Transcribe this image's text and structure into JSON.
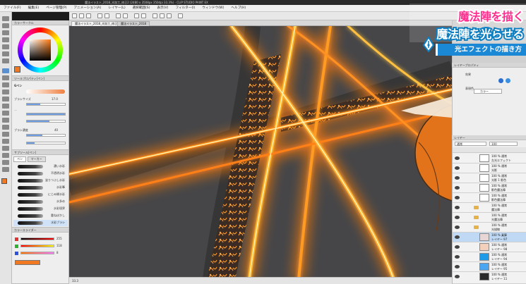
{
  "window": {
    "title": "魔法イラスト_2018_光加工_修正2 (2480 x 3508px 350dpi 33.3%) - CLIP STUDIO PAINT EX"
  },
  "menu": [
    "ファイル(F)",
    "編集(E)",
    "ページ管理(P)",
    "アニメーション(A)",
    "レイヤー(L)",
    "選択範囲(S)",
    "表示(V)",
    "フィルター(I)",
    "ウィンドウ(W)",
    "ヘルプ(H)"
  ],
  "tabs": {
    "canvas_tab": "魔法イラスト_2018_光加工_修正2",
    "canvas_tab2": "魔法イラスト_2018"
  },
  "panels": {
    "color_wheel": {
      "title": "カラーサークル",
      "main_color": "#f07820"
    },
    "tool_property": {
      "title": "ツールプロパティ[ペン]",
      "tool_name": "Gペン",
      "brush_size_label": "ブラシサイズ",
      "brush_size_value": "17.0",
      "brush_density_label": "ブラシ濃度",
      "brush_density_value": "40"
    },
    "sub_tool": {
      "title": "サブツール[ペン]",
      "tabs": [
        "ペン",
        "マーカー"
      ],
      "brushes": [
        "濃い水彩",
        "不透明水彩",
        "塗りつぶし水彩",
        "水彩筆",
        "にじみ縁水彩",
        "水多め",
        "水彩境界",
        "重ねぼかし",
        "水彩ブラシ"
      ],
      "selected_brush_index": 8
    },
    "color_slider": {
      "title": "カラースライダー",
      "values": [
        "255",
        "118",
        "8"
      ]
    }
  },
  "status": {
    "zoom": "33.3"
  },
  "right_panel": {
    "property_title": "レイヤープロパティ",
    "effect_label": "効果",
    "expression_label": "表現色",
    "expression_value": "カラー",
    "layer_title": "レイヤー",
    "blend_mode": "通常",
    "opacity": "100",
    "layers": [
      {
        "mode": "100 % 通常",
        "name": "左光エフェクト",
        "folder": false,
        "thumb": "#ffffff"
      },
      {
        "mode": "100 % 通常",
        "name": "光影",
        "folder": false,
        "thumb": "#ffffff"
      },
      {
        "mode": "100 % 通常",
        "name": "光影 1 影色",
        "folder": false,
        "thumb": "#ffffff"
      },
      {
        "mode": "100 % 通常",
        "name": "影色魔法陣",
        "folder": false,
        "thumb": "#ffffff"
      },
      {
        "mode": "100 % 通常",
        "name": "影色魔法陣",
        "folder": false,
        "thumb": "#ffffff"
      },
      {
        "mode": "100 % 通常",
        "name": "魔法陣",
        "folder": true,
        "thumb": "#ffffff"
      },
      {
        "mode": "100 % 通常",
        "name": "光魔法陣",
        "folder": true,
        "thumb": "#ffffff"
      },
      {
        "mode": "100 % 通常",
        "name": "光描線",
        "folder": true,
        "thumb": "#ffffff"
      },
      {
        "mode": "100 % 乗算",
        "name": "レイヤー 97",
        "folder": false,
        "thumb": "#e8d6d6"
      },
      {
        "mode": "100 % 通常",
        "name": "レイヤー 98",
        "folder": false,
        "thumb": "#f2d0bb"
      },
      {
        "mode": "100 % 通常",
        "name": "レイヤー 94",
        "folder": false,
        "thumb": "#1e9be8"
      },
      {
        "mode": "100 % 通常",
        "name": "レイヤー 95",
        "folder": false,
        "thumb": "#4aa6f0"
      },
      {
        "mode": "100 % 通常",
        "name": "レイヤー 96",
        "folder": false,
        "thumb": "#cfd6de"
      },
      {
        "mode": "100 % 通常",
        "name": "レイヤー 11",
        "folder": false,
        "thumb": "#2b2b2b"
      }
    ]
  },
  "banner": {
    "line1": "魔法陣を描く",
    "line2": "魔法陣を光らせる",
    "line3": "光エフェクトの描き方"
  }
}
